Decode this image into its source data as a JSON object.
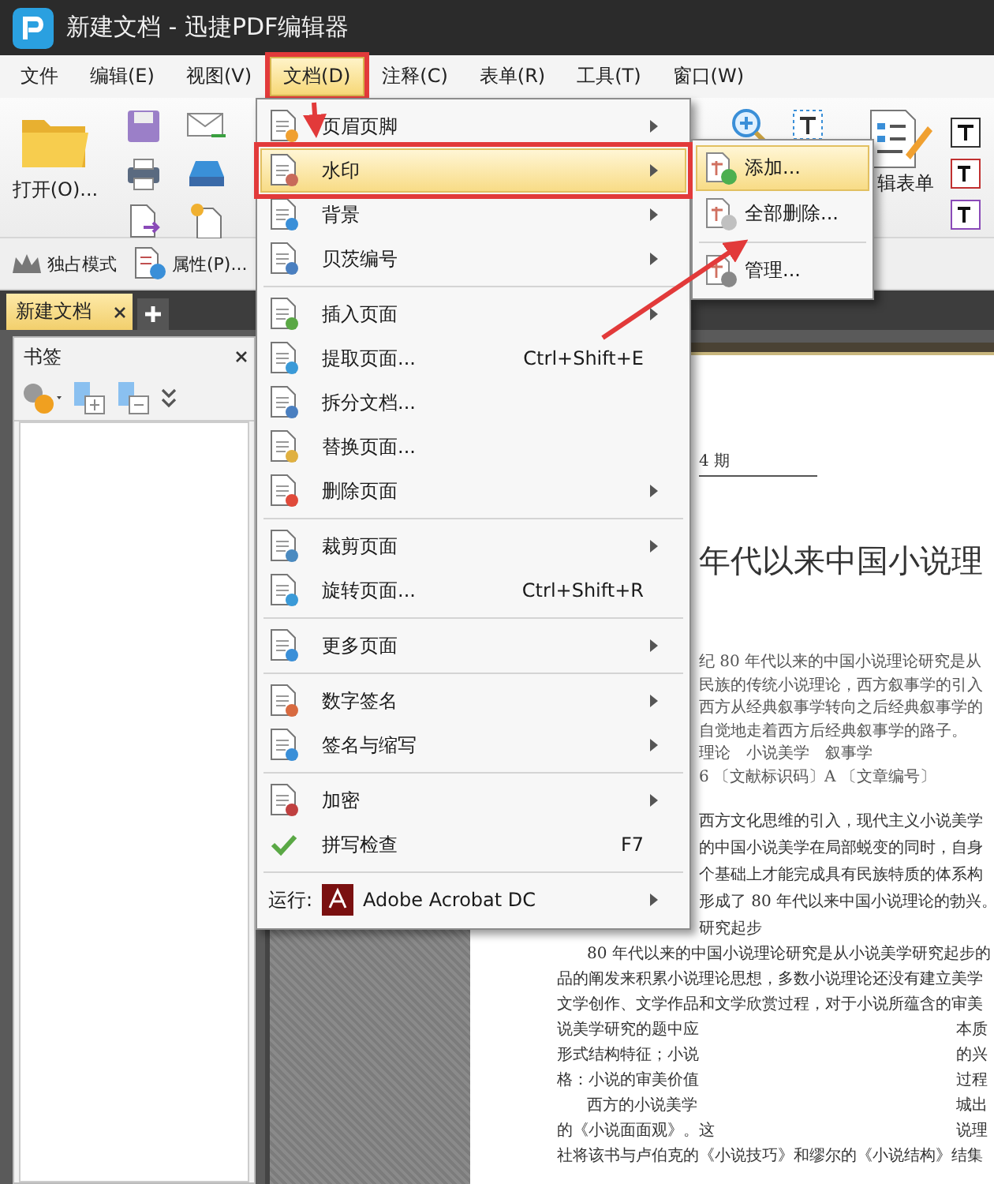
{
  "window": {
    "title": "新建文档 - 迅捷PDF编辑器"
  },
  "menu_bar": [
    {
      "label": "文件",
      "selected": false,
      "annotated": false
    },
    {
      "label": "编辑(E)",
      "selected": false,
      "annotated": false
    },
    {
      "label": "视图(V)",
      "selected": false,
      "annotated": false
    },
    {
      "label": "文档(D)",
      "selected": true,
      "annotated": true
    },
    {
      "label": "注释(C)",
      "selected": false,
      "annotated": false
    },
    {
      "label": "表单(R)",
      "selected": false,
      "annotated": false
    },
    {
      "label": "工具(T)",
      "selected": false,
      "annotated": false
    },
    {
      "label": "窗口(W)",
      "selected": false,
      "annotated": false
    }
  ],
  "toolbar": {
    "open_button": "打开(O)...",
    "edit_form_button": "辑表单"
  },
  "toolbar2": [
    {
      "label": "独占模式"
    },
    {
      "label": "属性(P)..."
    }
  ],
  "tabs": [
    {
      "label": "新建文档",
      "selected": true
    }
  ],
  "bookmarks_panel": {
    "title": "书签"
  },
  "document": {
    "issue": "4 期",
    "title": "年代以来中国小说理",
    "lines": [
      {
        "kind": "abstract",
        "text": "纪 80 年代以来的中国小说理论研究是从"
      },
      {
        "kind": "abstract",
        "text": "民族的传统小说理论，西方叙事学的引入"
      },
      {
        "kind": "abstract",
        "text": "西方从经典叙事学转向之后经典叙事学的"
      },
      {
        "kind": "abstract",
        "text": "自觉地走着西方后经典叙事学的路子。"
      },
      {
        "kind": "abstract",
        "text": "理论　小说美学　叙事学"
      },
      {
        "kind": "abstract",
        "text": "6 〔文献标识码〕A 〔文章编号〕"
      },
      {
        "kind": "covered",
        "text": "西方文化思维的引入，现代主义小说美学"
      },
      {
        "kind": "covered",
        "text": "的中国小说美学在局部蜕变的同时，自身"
      },
      {
        "kind": "covered",
        "text": "个基础上才能完成具有民族特质的体系构"
      },
      {
        "kind": "covered",
        "text": "形成了 80 年代以来中国小说理论的勃兴。"
      },
      {
        "kind": "covered",
        "text": "研究起步"
      },
      {
        "kind": "indent",
        "text": "80 年代以来的中国小说理论研究是从小说美学研究起步的"
      },
      {
        "kind": "body",
        "text": "品的阐发来积累小说理论思想，多数小说理论还没有建立美学"
      },
      {
        "kind": "body",
        "text": "文学创作、文学作品和文学欣赏过程，对于小说所蕴含的审美"
      },
      {
        "kind": "body",
        "text": "说美学研究的题中应",
        "text_right": "本质"
      },
      {
        "kind": "body",
        "text": "形式结构特征；小说",
        "text_right": "的兴"
      },
      {
        "kind": "body",
        "text": "格：小说的审美价值",
        "text_right": "过程"
      },
      {
        "kind": "indent",
        "text": "西方的小说美学",
        "text_right": "城出"
      },
      {
        "kind": "body",
        "text": "的《小说面面观》。这",
        "text_right": "说理"
      },
      {
        "kind": "body",
        "text": "社将该书与卢伯克的《小说技巧》和缪尔的《小说结构》结集"
      }
    ]
  },
  "document_menu": {
    "items": [
      {
        "kind": "item",
        "label": "页眉页脚",
        "submenu": true,
        "selected": false,
        "annotated": false
      },
      {
        "kind": "item",
        "label": "水印",
        "submenu": true,
        "selected": true,
        "annotated": true
      },
      {
        "kind": "item",
        "label": "背景",
        "submenu": true,
        "selected": false,
        "annotated": false
      },
      {
        "kind": "item",
        "label": "贝茨编号",
        "submenu": true,
        "selected": false,
        "annotated": false
      },
      {
        "kind": "separator"
      },
      {
        "kind": "item",
        "label": "插入页面",
        "submenu": true,
        "selected": false,
        "annotated": false
      },
      {
        "kind": "item",
        "label": "提取页面...",
        "shortcut": "Ctrl+Shift+E",
        "submenu": false,
        "selected": false,
        "annotated": false
      },
      {
        "kind": "item",
        "label": "拆分文档...",
        "submenu": false,
        "selected": false,
        "annotated": false
      },
      {
        "kind": "item",
        "label": "替换页面...",
        "submenu": false,
        "selected": false,
        "annotated": false
      },
      {
        "kind": "item",
        "label": "删除页面",
        "submenu": true,
        "selected": false,
        "annotated": false
      },
      {
        "kind": "separator"
      },
      {
        "kind": "item",
        "label": "裁剪页面",
        "submenu": true,
        "selected": false,
        "annotated": false
      },
      {
        "kind": "item",
        "label": "旋转页面...",
        "shortcut": "Ctrl+Shift+R",
        "submenu": false,
        "selected": false,
        "annotated": false
      },
      {
        "kind": "separator"
      },
      {
        "kind": "item",
        "label": "更多页面",
        "submenu": true,
        "selected": false,
        "annotated": false
      },
      {
        "kind": "separator"
      },
      {
        "kind": "item",
        "label": "数字签名",
        "submenu": true,
        "selected": false,
        "annotated": false
      },
      {
        "kind": "item",
        "label": "签名与缩写",
        "submenu": true,
        "selected": false,
        "annotated": false
      },
      {
        "kind": "separator"
      },
      {
        "kind": "item",
        "label": "加密",
        "submenu": true,
        "selected": false,
        "annotated": false
      },
      {
        "kind": "item",
        "label": "拼写检查",
        "shortcut": "F7",
        "submenu": false,
        "selected": false,
        "annotated": false
      },
      {
        "kind": "separator"
      },
      {
        "kind": "run",
        "label": "运行:",
        "app": "Adobe Acrobat DC",
        "submenu": true,
        "selected": false,
        "annotated": false
      }
    ]
  },
  "watermark_submenu": {
    "items": [
      {
        "kind": "item",
        "label": "添加...",
        "selected": true
      },
      {
        "kind": "item",
        "label": "全部删除...",
        "selected": false
      },
      {
        "kind": "separator"
      },
      {
        "kind": "item",
        "label": "管理...",
        "selected": false
      }
    ]
  }
}
